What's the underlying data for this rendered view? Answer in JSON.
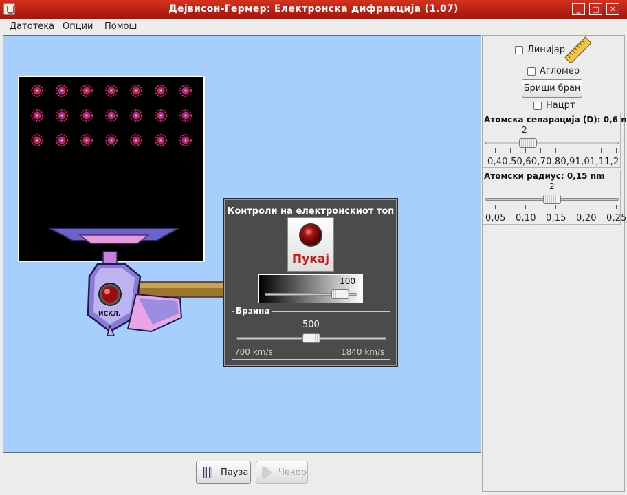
{
  "window": {
    "title": "Дејвисон-Гермер: Електронска дифракција (1.07)",
    "buttons": [
      "_",
      "□",
      "✕"
    ]
  },
  "menu": [
    "Датотека",
    "Опции",
    "Помош"
  ],
  "gun": {
    "off_label": "ИСКЛ."
  },
  "gun_controls": {
    "title": "Контроли на електронскиот топ",
    "fire_label": "Пукај",
    "intensity_value": "100",
    "intensity_fraction": 0.9,
    "speed_title": "Брзина",
    "speed_value": "500",
    "speed_fraction": 0.5,
    "speed_min": "700 km/s",
    "speed_max": "1840 km/s"
  },
  "tools": {
    "ruler_label": "Линијар",
    "protractor_label": "Агломер",
    "erase_label": "Бриши бран",
    "sketch_label": "Нацрт"
  },
  "atomic_separation": {
    "title": "Атомска сепарација (D): 0,6 nm",
    "value": "2",
    "ticks": "0,40,50,60,70,80,91,01,11,2",
    "slider_fraction": 0.29
  },
  "atomic_radius": {
    "title": "Атомски радиус: 0,15 nm",
    "value": "2",
    "ticks": [
      "0,05",
      "0,10",
      "0,15",
      "0,20",
      "0,25"
    ],
    "slider_fraction": 0.5
  },
  "bottom": {
    "pause_label": "Пауза",
    "step_label": "Чекор"
  },
  "colors": {
    "titlebar": "#c0281a",
    "sim_background": "#a6cffd",
    "fire_text": "#c8191b",
    "gun_body": "#8a7ad8",
    "atom": "#e0206a"
  }
}
